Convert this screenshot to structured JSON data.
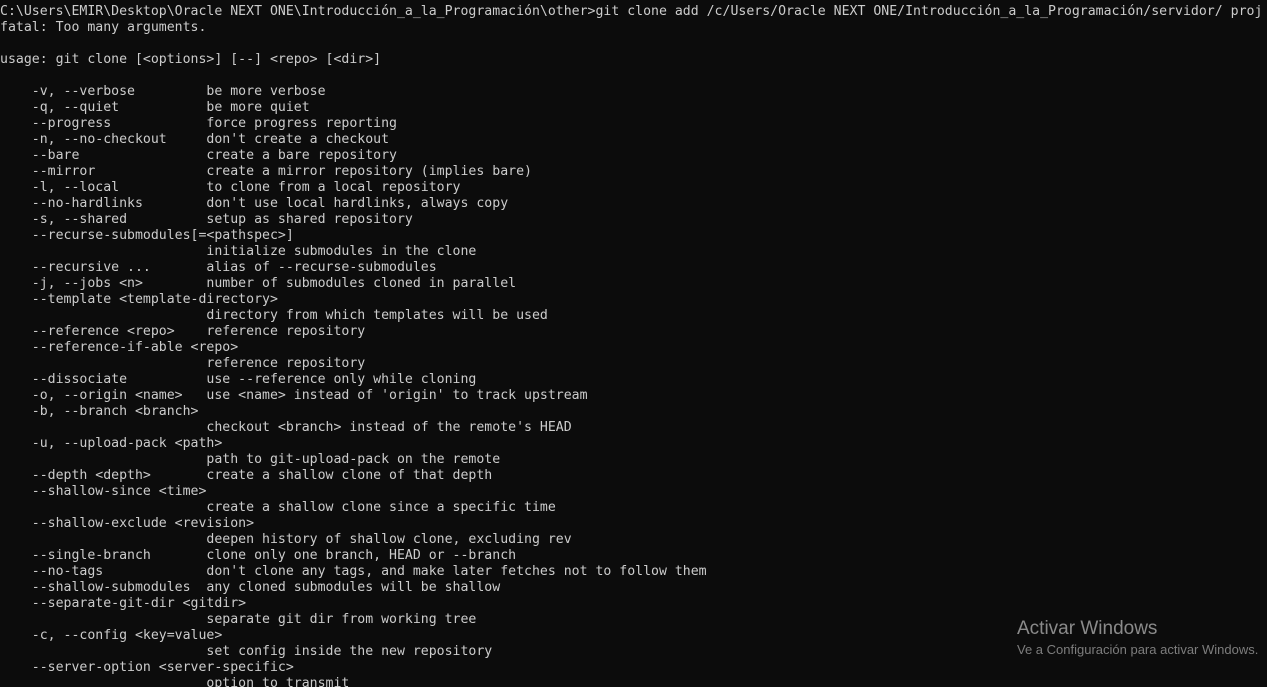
{
  "terminal": {
    "shell": "cmd",
    "background_color": "#0c0c0c",
    "text_color": "#cccccc",
    "prompt": "C:\\Users\\EMIR\\Desktop\\Oracle NEXT ONE\\Introducción_a_la_Programación\\other>",
    "typed_command": "git clone add /c/Users/Oracle NEXT ONE/Introducción_a_la_Programación/servidor/ proj",
    "lines": [
      "C:\\Users\\EMIR\\Desktop\\Oracle NEXT ONE\\Introducción_a_la_Programación\\other>git clone add /c/Users/Oracle NEXT ONE/Introducción_a_la_Programación/servidor/ proj",
      "fatal: Too many arguments.",
      "",
      "usage: git clone [<options>] [--] <repo> [<dir>]",
      "",
      "    -v, --verbose         be more verbose",
      "    -q, --quiet           be more quiet",
      "    --progress            force progress reporting",
      "    -n, --no-checkout     don't create a checkout",
      "    --bare                create a bare repository",
      "    --mirror              create a mirror repository (implies bare)",
      "    -l, --local           to clone from a local repository",
      "    --no-hardlinks        don't use local hardlinks, always copy",
      "    -s, --shared          setup as shared repository",
      "    --recurse-submodules[=<pathspec>]",
      "                          initialize submodules in the clone",
      "    --recursive ...       alias of --recurse-submodules",
      "    -j, --jobs <n>        number of submodules cloned in parallel",
      "    --template <template-directory>",
      "                          directory from which templates will be used",
      "    --reference <repo>    reference repository",
      "    --reference-if-able <repo>",
      "                          reference repository",
      "    --dissociate          use --reference only while cloning",
      "    -o, --origin <name>   use <name> instead of 'origin' to track upstream",
      "    -b, --branch <branch>",
      "                          checkout <branch> instead of the remote's HEAD",
      "    -u, --upload-pack <path>",
      "                          path to git-upload-pack on the remote",
      "    --depth <depth>       create a shallow clone of that depth",
      "    --shallow-since <time>",
      "                          create a shallow clone since a specific time",
      "    --shallow-exclude <revision>",
      "                          deepen history of shallow clone, excluding rev",
      "    --single-branch       clone only one branch, HEAD or --branch",
      "    --no-tags             don't clone any tags, and make later fetches not to follow them",
      "    --shallow-submodules  any cloned submodules will be shallow",
      "    --separate-git-dir <gitdir>",
      "                          separate git dir from working tree",
      "    -c, --config <key=value>",
      "                          set config inside the new repository",
      "    --server-option <server-specific>",
      "                          option to transmit"
    ]
  },
  "watermark": {
    "title": "Activar Windows",
    "subtitle": "Ve a Configuración para activar Windows."
  }
}
